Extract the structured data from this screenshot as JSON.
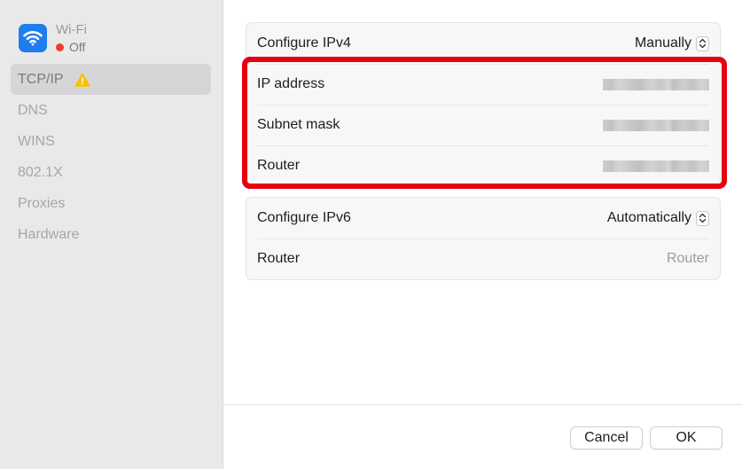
{
  "sidebar": {
    "device": {
      "name": "Wi-Fi",
      "status": "Off",
      "icon": "wifi-icon",
      "status_color": "#ee3b30"
    },
    "items": [
      {
        "label": "TCP/IP",
        "selected": true,
        "warning_icon": "warning-icon"
      },
      {
        "label": "DNS"
      },
      {
        "label": "WINS"
      },
      {
        "label": "802.1X"
      },
      {
        "label": "Proxies"
      },
      {
        "label": "Hardware"
      }
    ]
  },
  "ipv4": {
    "configure_label": "Configure IPv4",
    "configure_value": "Manually",
    "ip_label": "IP address",
    "subnet_label": "Subnet mask",
    "router_label": "Router"
  },
  "ipv6": {
    "configure_label": "Configure IPv6",
    "configure_value": "Automatically",
    "router_label": "Router",
    "router_placeholder": "Router"
  },
  "footer": {
    "cancel_label": "Cancel",
    "ok_label": "OK"
  },
  "colors": {
    "highlight": "#e60012",
    "accent": "#1f7df0"
  }
}
